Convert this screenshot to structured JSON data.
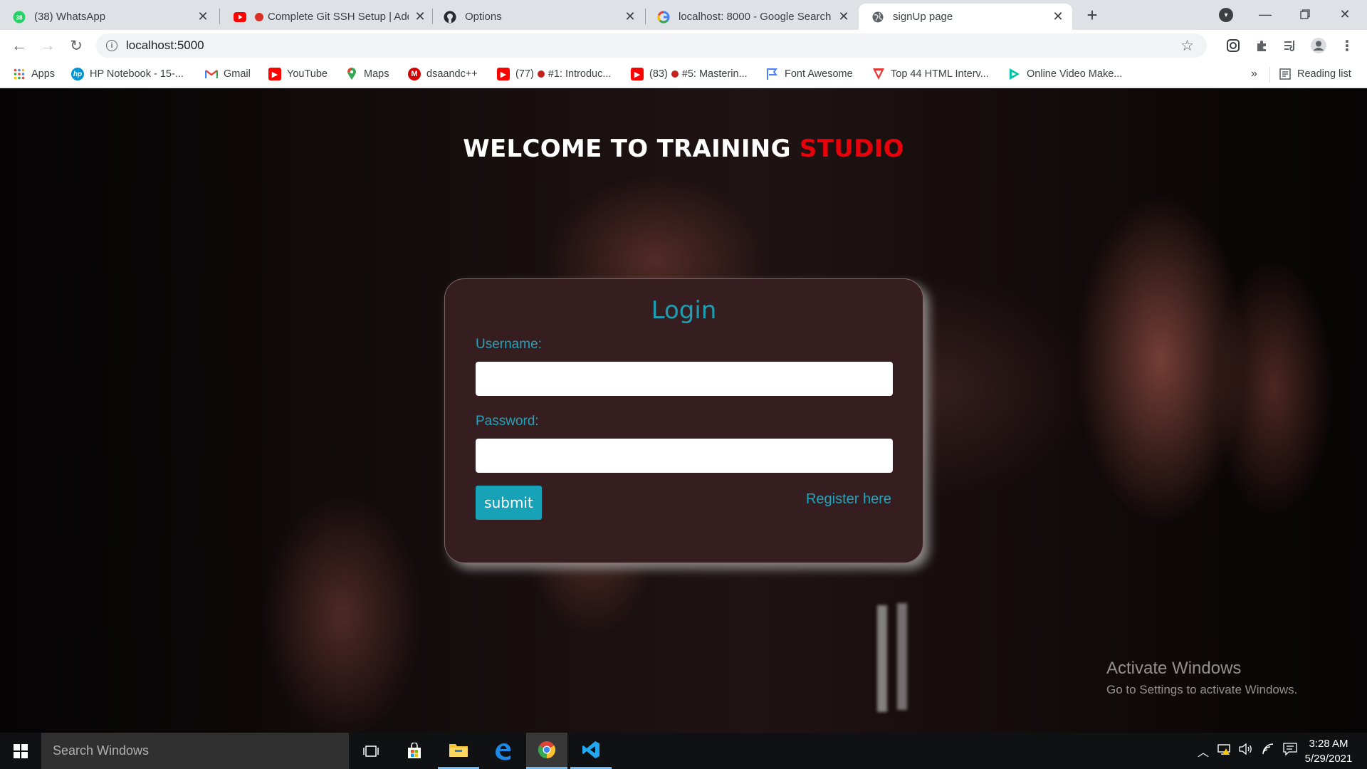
{
  "browser": {
    "tabs": [
      {
        "title": "(38) WhatsApp",
        "icon": "whatsapp-icon",
        "badge": "38"
      },
      {
        "title": "Complete Git SSH Setup | Add",
        "icon": "youtube-icon"
      },
      {
        "title": "Options",
        "icon": "github-icon"
      },
      {
        "title": "localhost: 8000 - Google Search",
        "icon": "google-icon"
      },
      {
        "title": "signUp page",
        "icon": "globe-icon",
        "active": true
      }
    ],
    "url": "localhost:5000",
    "bookmarks": [
      {
        "label": "Apps",
        "icon": "apps-grid-icon"
      },
      {
        "label": "HP Notebook - 15-...",
        "icon": "hp-icon"
      },
      {
        "label": "Gmail",
        "icon": "gmail-icon"
      },
      {
        "label": "YouTube",
        "icon": "youtube-icon"
      },
      {
        "label": "Maps",
        "icon": "maps-icon"
      },
      {
        "label": "dsaandc++",
        "icon": "m-icon"
      },
      {
        "label": "(77)",
        "label2": "#1: Introduc...",
        "icon": "youtube-icon"
      },
      {
        "label": "(83)",
        "label2": "#5: Masterin...",
        "icon": "youtube-icon"
      },
      {
        "label": "Font Awesome",
        "icon": "flag-icon"
      },
      {
        "label": "Top 44 HTML Interv...",
        "icon": "v-icon"
      },
      {
        "label": "Online Video Make...",
        "icon": "play-icon"
      }
    ],
    "more_bookmarks": "»",
    "reading_list": "Reading list"
  },
  "page": {
    "heading_main": "WELCOME TO TRAINING ",
    "heading_accent": "STUDIO",
    "form": {
      "title": "Login",
      "username_label": "Username:",
      "username_value": "",
      "password_label": "Password:",
      "password_value": "",
      "submit_label": "submit",
      "register_link": "Register here"
    }
  },
  "watermark": {
    "line1": "Activate Windows",
    "line2": "Go to Settings to activate Windows."
  },
  "taskbar": {
    "search_placeholder": "Search Windows",
    "time": "3:28 AM",
    "date": "5/29/2021"
  },
  "colors": {
    "accent_red": "#e8000b",
    "form_teal": "#17a2b8",
    "card_bg": "#361d1f"
  }
}
